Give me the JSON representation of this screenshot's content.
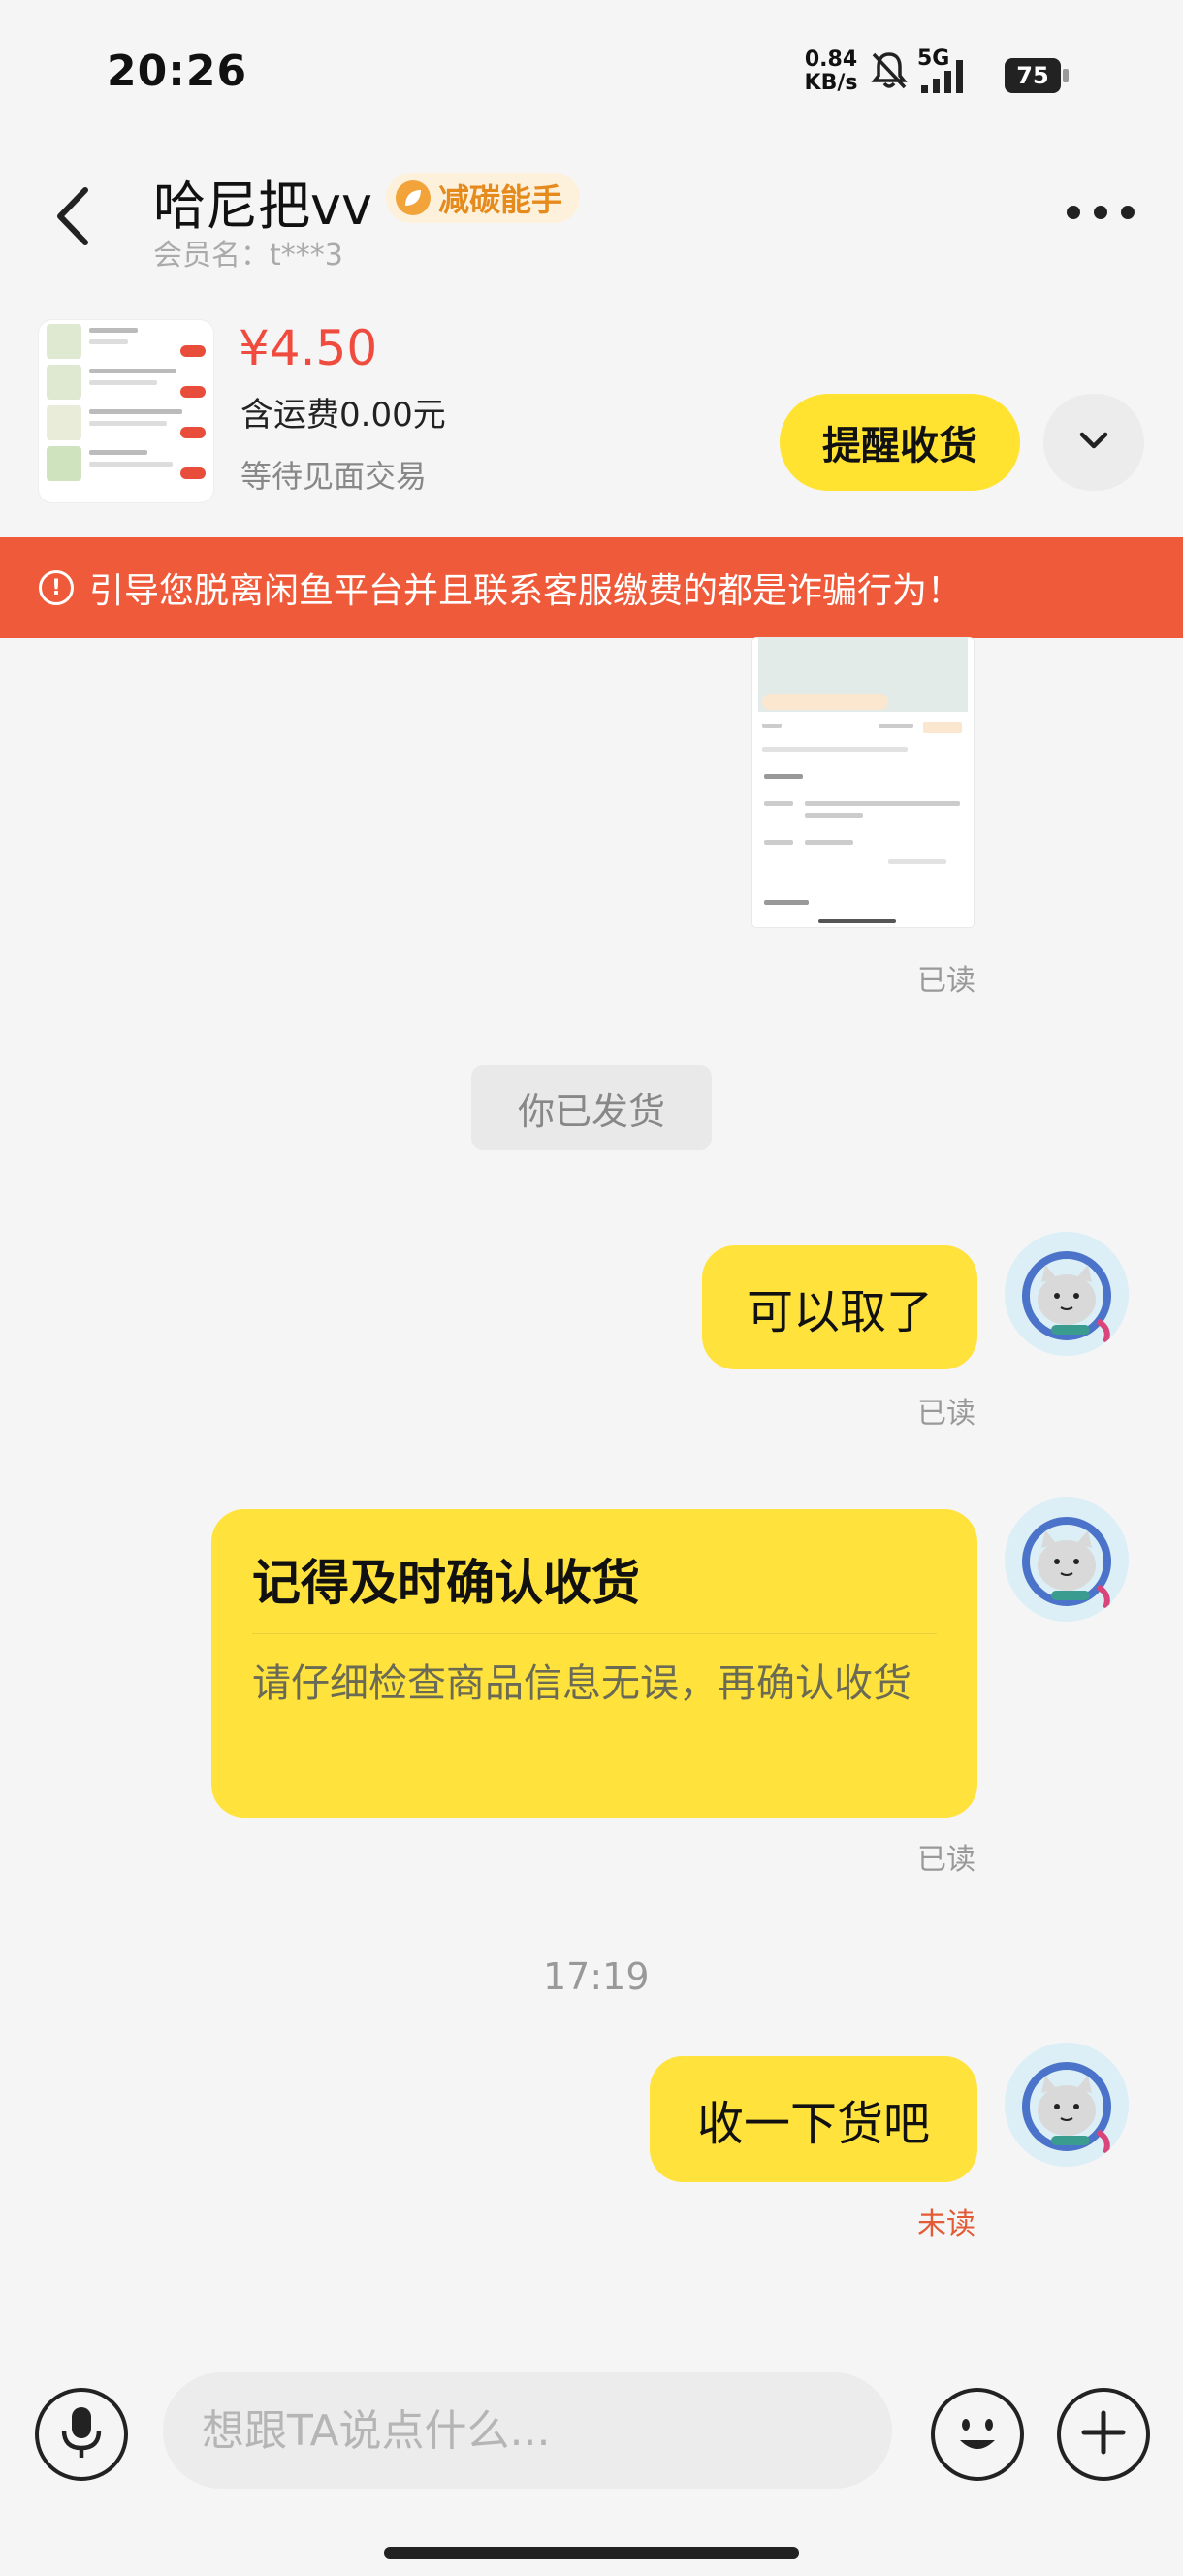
{
  "status_bar": {
    "time": "20:26",
    "net_speed_value": "0.84",
    "net_speed_unit": "KB/s",
    "network": "5G",
    "battery": "75"
  },
  "header": {
    "contact_name": "哈尼把vv",
    "badge_label": "减碳能手",
    "member_label": "会员名：t***3"
  },
  "product": {
    "price": "¥4.50",
    "shipping": "含运费0.00元",
    "trade_status": "等待见面交易",
    "remind_label": "提醒收货"
  },
  "warning": {
    "text": "引导您脱离闲鱼平台并且联系客服缴费的都是诈骗行为！"
  },
  "messages": {
    "read_label": "已读",
    "unread_label": "未读",
    "system_notice": "你已发货",
    "msg1": "可以取了",
    "card_title": "记得及时确认收货",
    "card_body": "请仔细检查商品信息无误，再确认收货",
    "timestamp": "17:19",
    "msg3": "收一下货吧"
  },
  "input": {
    "placeholder": "想跟TA说点什么..."
  },
  "colors": {
    "accent_yellow": "#ffe33c",
    "warning_red": "#ef5b3a",
    "price_red": "#ef4b3e",
    "badge_orange": "#e58a1c"
  }
}
